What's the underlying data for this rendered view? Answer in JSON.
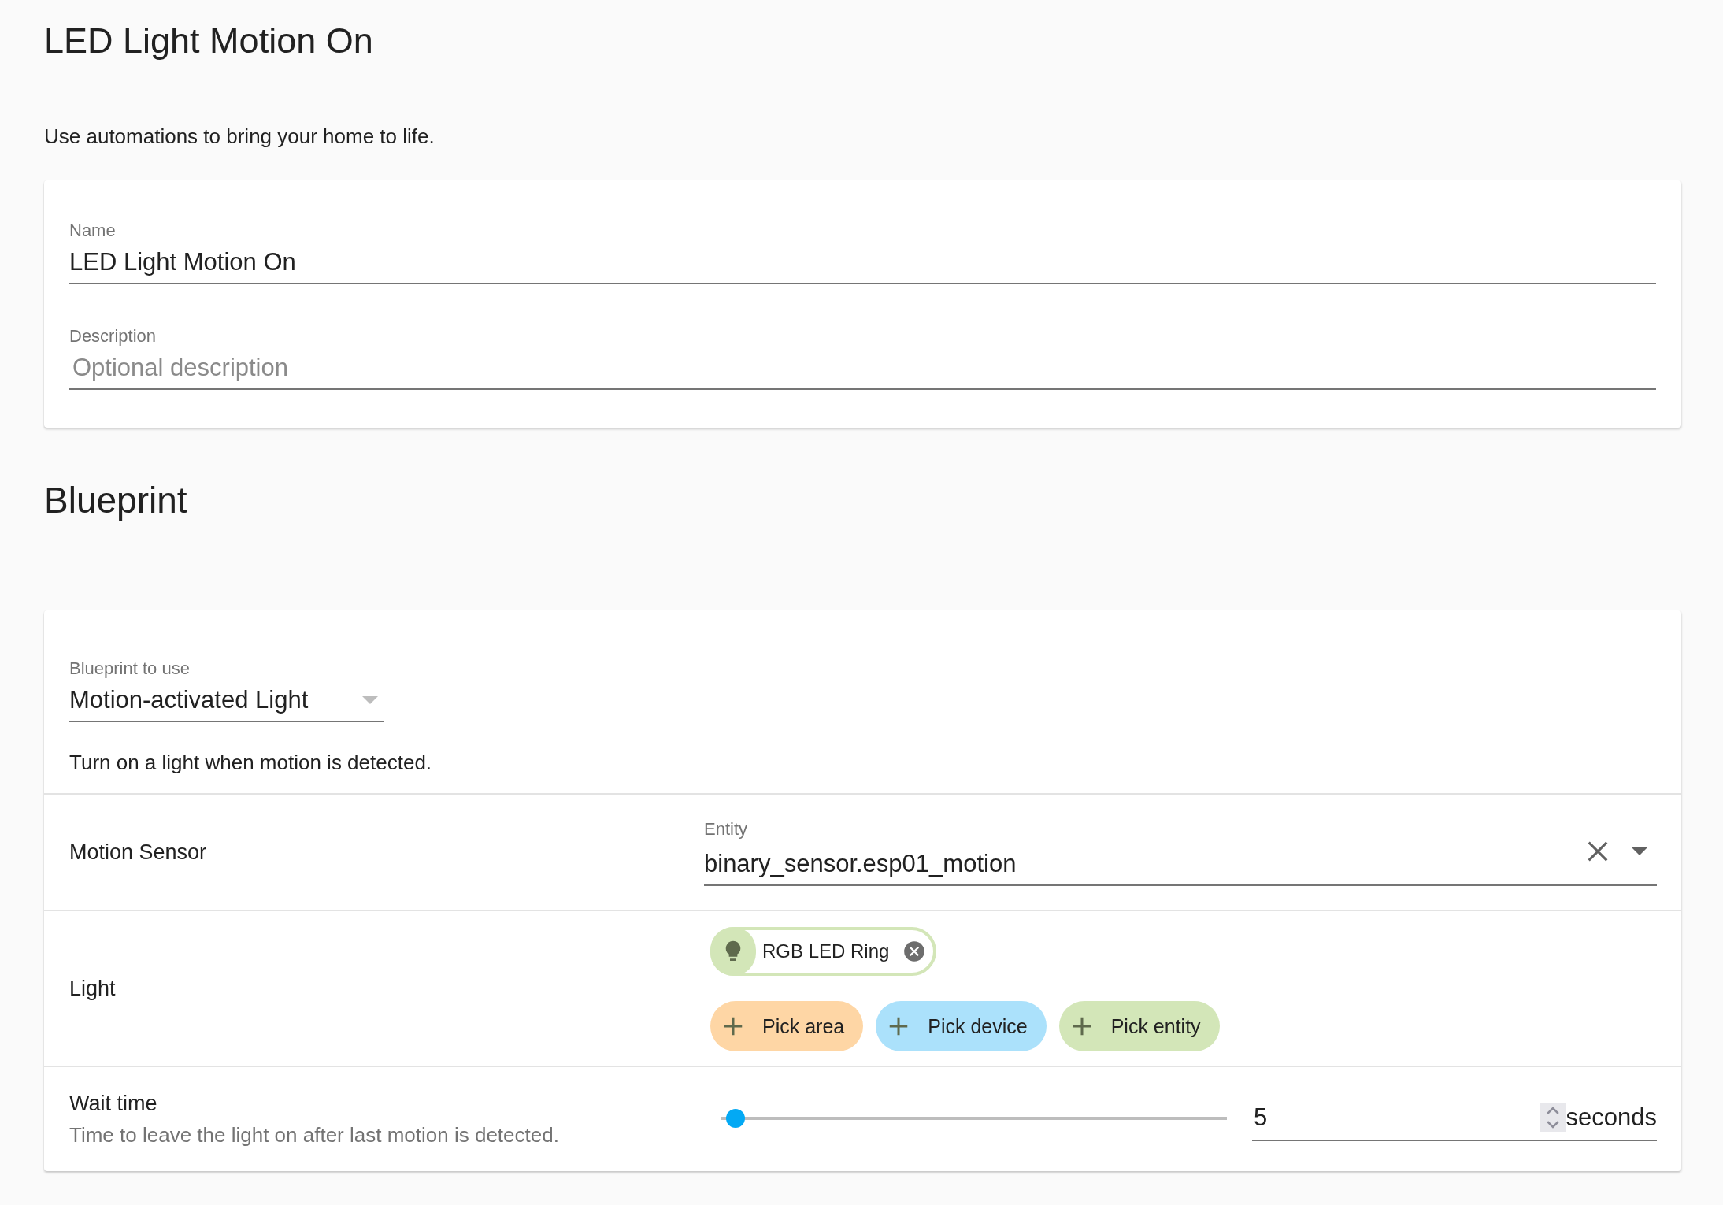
{
  "header": {
    "title": "LED Light Motion On",
    "intro": "Use automations to bring your home to life."
  },
  "details_card": {
    "fields": [
      {
        "label": "Name",
        "value": "LED Light Motion On"
      },
      {
        "label": "Description",
        "placeholder": "Optional description"
      }
    ]
  },
  "blueprint_section": {
    "heading": "Blueprint"
  },
  "blueprint_card": {
    "select": {
      "label": "Blueprint to use",
      "value": "Motion-activated Light"
    },
    "description": "Turn on a light when motion is detected.",
    "inputs": [
      {
        "kind": "entity",
        "name": "Motion Sensor",
        "field_label": "Entity",
        "value": "binary_sensor.esp01_motion"
      },
      {
        "kind": "target",
        "name": "Light",
        "chips": [
          {
            "label": "RGB LED Ring",
            "color": "#d3e6b8"
          }
        ],
        "pickers": [
          {
            "label": "Pick area",
            "color": "#fed6a5"
          },
          {
            "label": "Pick device",
            "color": "#abe1fb"
          },
          {
            "label": "Pick entity",
            "color": "#d3e6b8"
          }
        ]
      },
      {
        "kind": "slider",
        "name": "Wait time",
        "description": "Time to leave the light on after last motion is detected.",
        "level": 0.01,
        "value": "5",
        "unit": "seconds"
      }
    ]
  }
}
